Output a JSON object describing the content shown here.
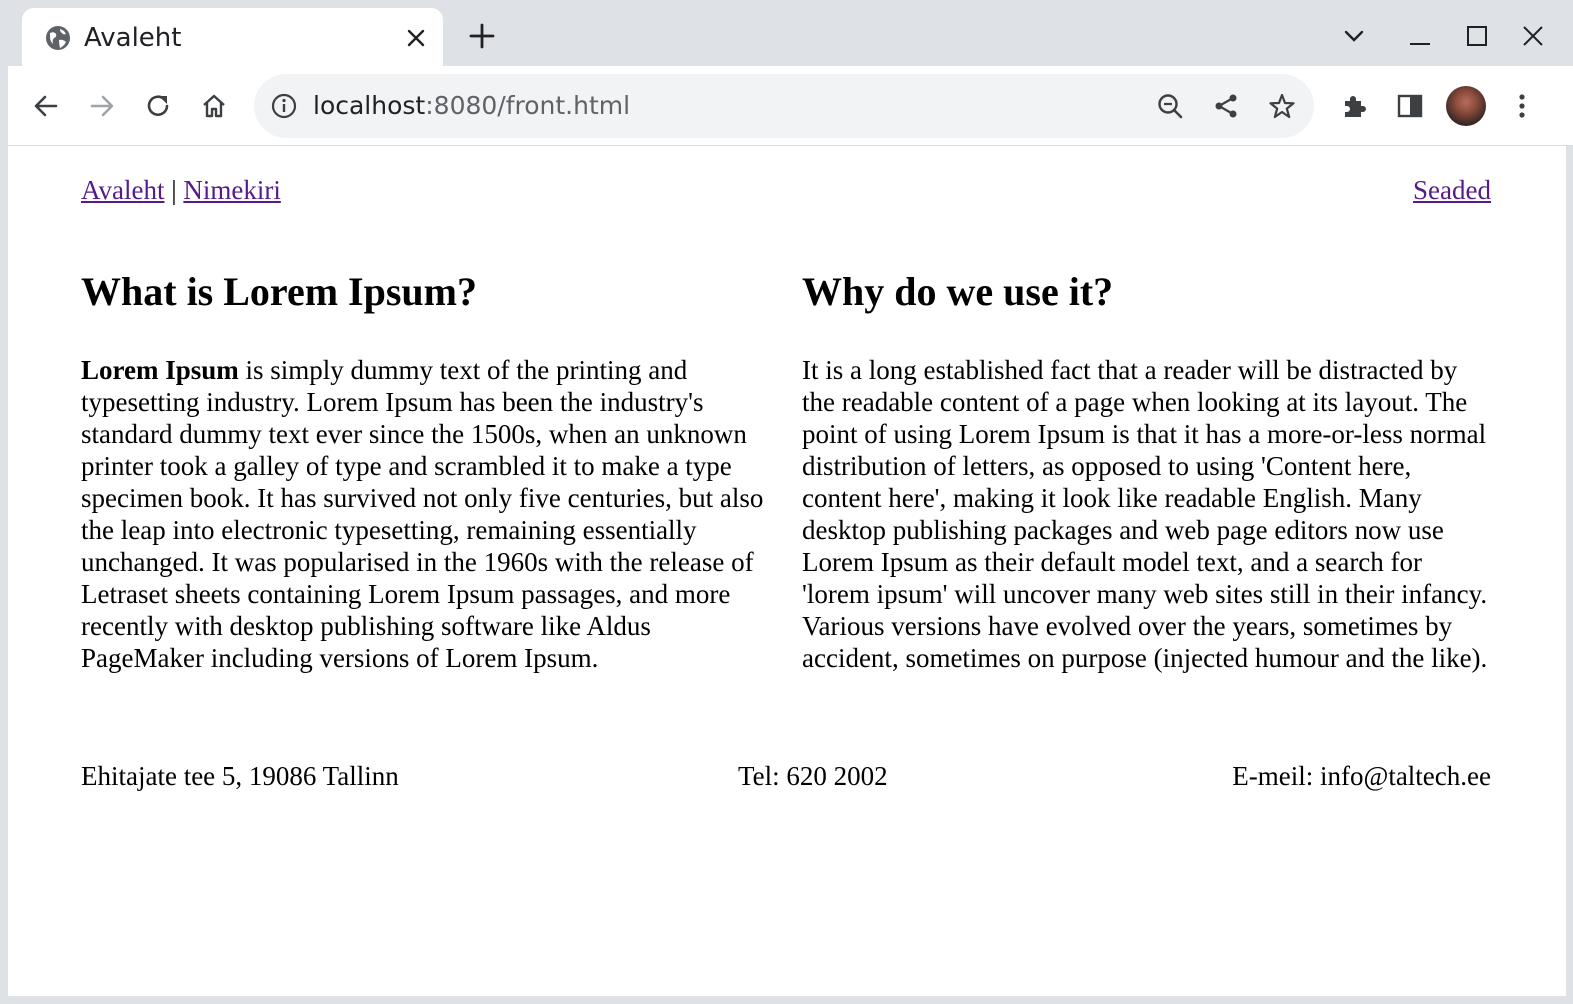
{
  "browser": {
    "tab": {
      "title": "Avaleht"
    },
    "address": {
      "host": "localhost",
      "rest": ":8080/front.html"
    }
  },
  "page": {
    "nav": {
      "home": "Avaleht",
      "separator": "|",
      "list": "Nimekiri",
      "settings": "Seaded"
    },
    "left": {
      "heading": "What is Lorem Ipsum?",
      "lead": "Lorem Ipsum",
      "body": " is simply dummy text of the printing and typesetting industry. Lorem Ipsum has been the industry's standard dummy text ever since the 1500s, when an unknown printer took a galley of type and scrambled it to make a type specimen book. It has survived not only five centuries, but also the leap into electronic typesetting, remaining essentially unchanged. It was popularised in the 1960s with the release of Letraset sheets containing Lorem Ipsum passages, and more recently with desktop publishing software like Aldus PageMaker including versions of Lorem Ipsum."
    },
    "right": {
      "heading": "Why do we use it?",
      "body": "It is a long established fact that a reader will be distracted by the readable content of a page when looking at its layout. The point of using Lorem Ipsum is that it has a more-or-less normal distribution of letters, as opposed to using 'Content here, content here', making it look like readable English. Many desktop publishing packages and web page editors now use Lorem Ipsum as their default model text, and a search for 'lorem ipsum' will uncover many web sites still in their infancy. Various versions have evolved over the years, sometimes by accident, sometimes on purpose (injected humour and the like)."
    },
    "footer": {
      "address": "Ehitajate tee 5, 19086 Tallinn",
      "phone": "Tel: 620 2002",
      "email": "E-meil: info@taltech.ee"
    }
  },
  "colors": {
    "visited_link": "#551a8b",
    "chrome_frame": "#dee1e6",
    "omnibox_bg": "#f1f3f4"
  },
  "icons": [
    "globe-icon",
    "close-icon",
    "plus-icon",
    "chevron-down-icon",
    "minimize-icon",
    "maximize-icon",
    "back-icon",
    "forward-icon",
    "reload-icon",
    "home-icon",
    "info-icon",
    "zoom-out-icon",
    "share-icon",
    "star-icon",
    "extensions-icon",
    "side-panel-icon",
    "more-icon"
  ]
}
